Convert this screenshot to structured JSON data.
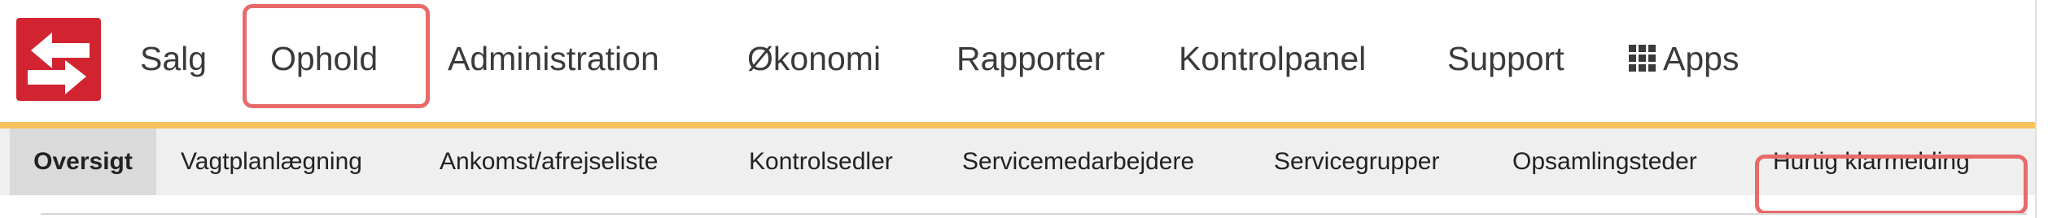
{
  "logo": {
    "icon": "sf-logo-icon",
    "brand_color": "#d12430"
  },
  "main_nav": {
    "items": [
      {
        "label": "Salg"
      },
      {
        "label": "Ophold",
        "highlighted": true
      },
      {
        "label": "Administration"
      },
      {
        "label": "Økonomi"
      },
      {
        "label": "Rapporter"
      },
      {
        "label": "Kontrolpanel"
      },
      {
        "label": "Support"
      },
      {
        "label": "Apps",
        "icon": "apps-grid-icon"
      }
    ]
  },
  "sub_nav": {
    "items": [
      {
        "label": "Oversigt",
        "active": true
      },
      {
        "label": "Vagtplanlægning"
      },
      {
        "label": "Ankomst/afrejseliste"
      },
      {
        "label": "Kontrolsedler"
      },
      {
        "label": "Servicemedarbejdere"
      },
      {
        "label": "Servicegrupper"
      },
      {
        "label": "Opsamlingsteder"
      },
      {
        "label": "Hurtig klarmelding",
        "highlighted": true
      }
    ]
  },
  "colors": {
    "accent_line": "#f6c25b",
    "highlight_border": "#e86a6a",
    "subnav_background": "#efefef",
    "active_tab_background": "#dadada"
  }
}
